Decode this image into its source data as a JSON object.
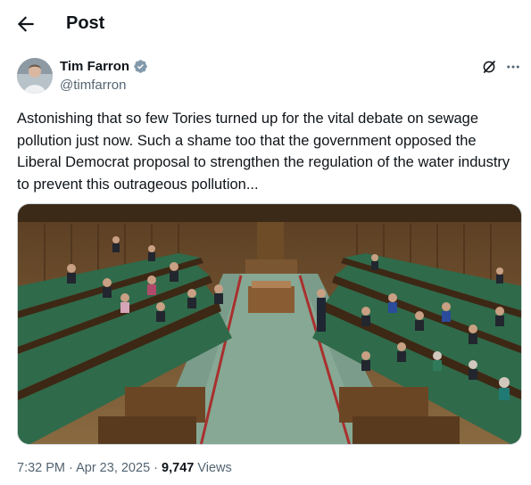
{
  "header": {
    "title": "Post",
    "back_icon": "arrow-left-icon"
  },
  "author": {
    "name": "Tim Farron",
    "handle": "@timfarron",
    "verified_icon": "verified-badge-icon",
    "verified_color": "#829aab"
  },
  "actions": {
    "grok_icon": "grok-icon",
    "more_icon": "more-dots-icon"
  },
  "tweet": {
    "text": "Astonishing that so few Tories turned up for the vital debate on sewage pollution just now. Such a shame too that the government opposed the Liberal Democrat proposal to strengthen the regulation of the water industry to prevent this outrageous pollution..."
  },
  "media": {
    "icon": "photo-commons-chamber"
  },
  "meta": {
    "time": "7:32 PM",
    "sep1": " · ",
    "date": "Apr 23, 2025",
    "sep2": " · ",
    "views_count": "9,747",
    "views_label": " Views"
  },
  "colors": {
    "text": "#0f1419",
    "secondary": "#536471",
    "border": "#cfd9de"
  }
}
